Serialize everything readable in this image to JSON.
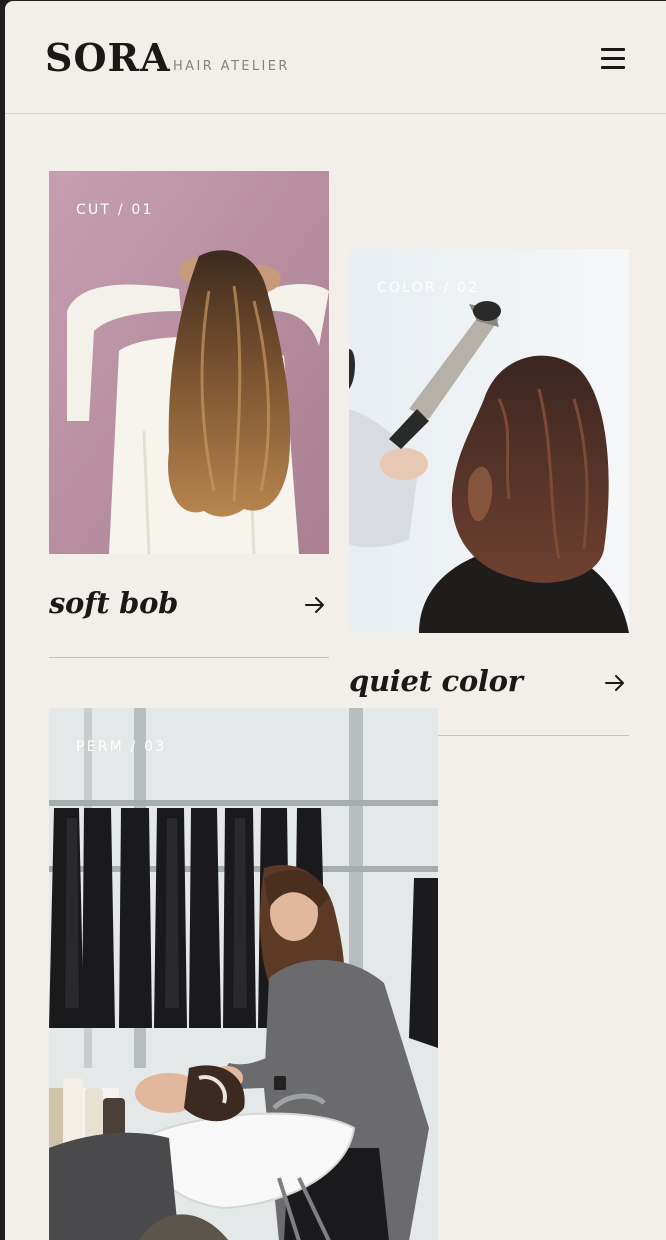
{
  "brand": {
    "name": "SORA",
    "tagline": "HAIR ATELIER"
  },
  "header": {
    "menu_icon": "hamburger-menu-icon"
  },
  "cards": [
    {
      "tag": "CUT / 01",
      "title": "soft bob",
      "arrow_icon": "arrow-right-icon"
    },
    {
      "tag": "COLOR / 02",
      "title": "quiet color",
      "arrow_icon": "arrow-right-icon"
    },
    {
      "tag": "PERM / 03"
    }
  ],
  "colors": {
    "background": "#f2efeb",
    "text": "#1b1917",
    "muted": "#8a827a",
    "divider": "#c9c1b8"
  }
}
